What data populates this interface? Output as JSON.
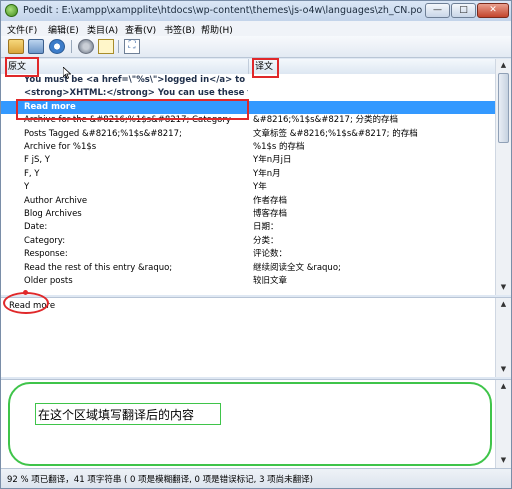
{
  "window": {
    "title": "Poedit : E:\\xampp\\xampplite\\htdocs\\wp-content\\themes\\js-o4w\\languages\\zh_CN.po",
    "min_symbol": "—",
    "max_symbol": "□",
    "close_symbol": "✕"
  },
  "menu": [
    "文件(F)",
    "编辑(E)",
    "类目(A)",
    "查看(V)",
    "书签(B)",
    "帮助(H)"
  ],
  "toolbar_icons": [
    "open-icon",
    "save-icon",
    "update-catalog-icon",
    "catalog-settings-icon",
    "comment-icon",
    "fullscreen-icon"
  ],
  "list": {
    "header_source": "原文",
    "header_translation": "译文",
    "rows": [
      {
        "source": "You must be <a href=\\\"%s\\\">logged in</a> to post a ...",
        "translation": "",
        "bold": true,
        "selected": false
      },
      {
        "source": "<strong>XHTML:</strong> You can use these tags: <c...",
        "translation": "",
        "bold": true,
        "selected": false
      },
      {
        "source": "Read more",
        "translation": "",
        "bold": true,
        "selected": true
      },
      {
        "source": "Archive for the &#8216;%1$s&#8217; Category",
        "translation": "&#8216;%1$s&#8217; 分类的存档",
        "bold": false,
        "selected": false
      },
      {
        "source": "Posts Tagged &#8216;%1$s&#8217;",
        "translation": "文章标签 &#8216;%1$s&#8217; 的存档",
        "bold": false,
        "selected": false
      },
      {
        "source": "Archive for %1$s",
        "translation": "%1$s 的存档",
        "bold": false,
        "selected": false
      },
      {
        "source": "F jS, Y",
        "translation": "Y年n月j日",
        "bold": false,
        "selected": false
      },
      {
        "source": "F, Y",
        "translation": "Y年n月",
        "bold": false,
        "selected": false
      },
      {
        "source": "Y",
        "translation": "Y年",
        "bold": false,
        "selected": false
      },
      {
        "source": "Author Archive",
        "translation": "作者存档",
        "bold": false,
        "selected": false
      },
      {
        "source": "Blog Archives",
        "translation": "博客存档",
        "bold": false,
        "selected": false
      },
      {
        "source": "Date:",
        "translation": "日期：",
        "bold": false,
        "selected": false
      },
      {
        "source": "Category:",
        "translation": "分类：",
        "bold": false,
        "selected": false
      },
      {
        "source": "Response:",
        "translation": "评论数：",
        "bold": false,
        "selected": false
      },
      {
        "source": "Read the rest of this entry &raquo;",
        "translation": "继续阅读全文 &raquo;",
        "bold": false,
        "selected": false
      },
      {
        "source": "Older posts",
        "translation": "较旧文章",
        "bold": false,
        "selected": false
      }
    ]
  },
  "source_pane": {
    "text": "Read more"
  },
  "annotation": {
    "translation_hint": "在这个区域填写翻译后的内容"
  },
  "status": {
    "text": "92 % 项已翻译，41 项字符串 ( 0 项是模糊翻译, 0 项是错误标记, 3 项尚未翻译)"
  },
  "colors": {
    "selection": "#3399ff",
    "annotation_red": "#e0282a",
    "annotation_green": "#3fc44a"
  }
}
